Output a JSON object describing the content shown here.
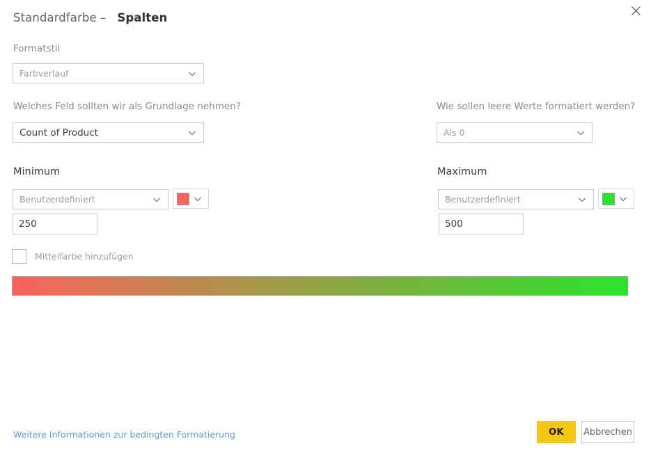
{
  "dialog": {
    "header_prefix": "Standardfarbe –",
    "header_title": "Spalten",
    "close_icon": "close-icon"
  },
  "format_style": {
    "label": "Formatstil",
    "value": "Farbverlauf",
    "chevron_icon": "chevron-down-icon"
  },
  "base_field": {
    "label": "Welches Feld sollten wir als Grundlage nehmen?",
    "value": "Count of Product",
    "chevron_icon": "chevron-down-icon"
  },
  "empty_values": {
    "label": "Wie sollen leere Werte formatiert werden?",
    "value": "Als 0",
    "chevron_icon": "chevron-down-icon"
  },
  "minimum": {
    "section_label": "Minimum",
    "mode": "Benutzerdefiniert",
    "color": "#F9635C",
    "number": "250",
    "chevron_icon": "chevron-down-icon",
    "swatch_icon": "color-swatch-icon"
  },
  "maximum": {
    "section_label": "Maximum",
    "mode": "Benutzerdefiniert",
    "color": "#2BE32B",
    "number": "500",
    "chevron_icon": "chevron-down-icon",
    "swatch_icon": "color-swatch-icon"
  },
  "middle_color": {
    "label": "Mittelfarbe hinzufügen",
    "checked": false
  },
  "preview": {
    "start_color": "#F9635C",
    "end_color": "#2BE32B"
  },
  "footer": {
    "link_text": "Weitere Informationen zur bedingten Formatierung",
    "ok_label": "OK",
    "cancel_label": "Abbrechen"
  }
}
